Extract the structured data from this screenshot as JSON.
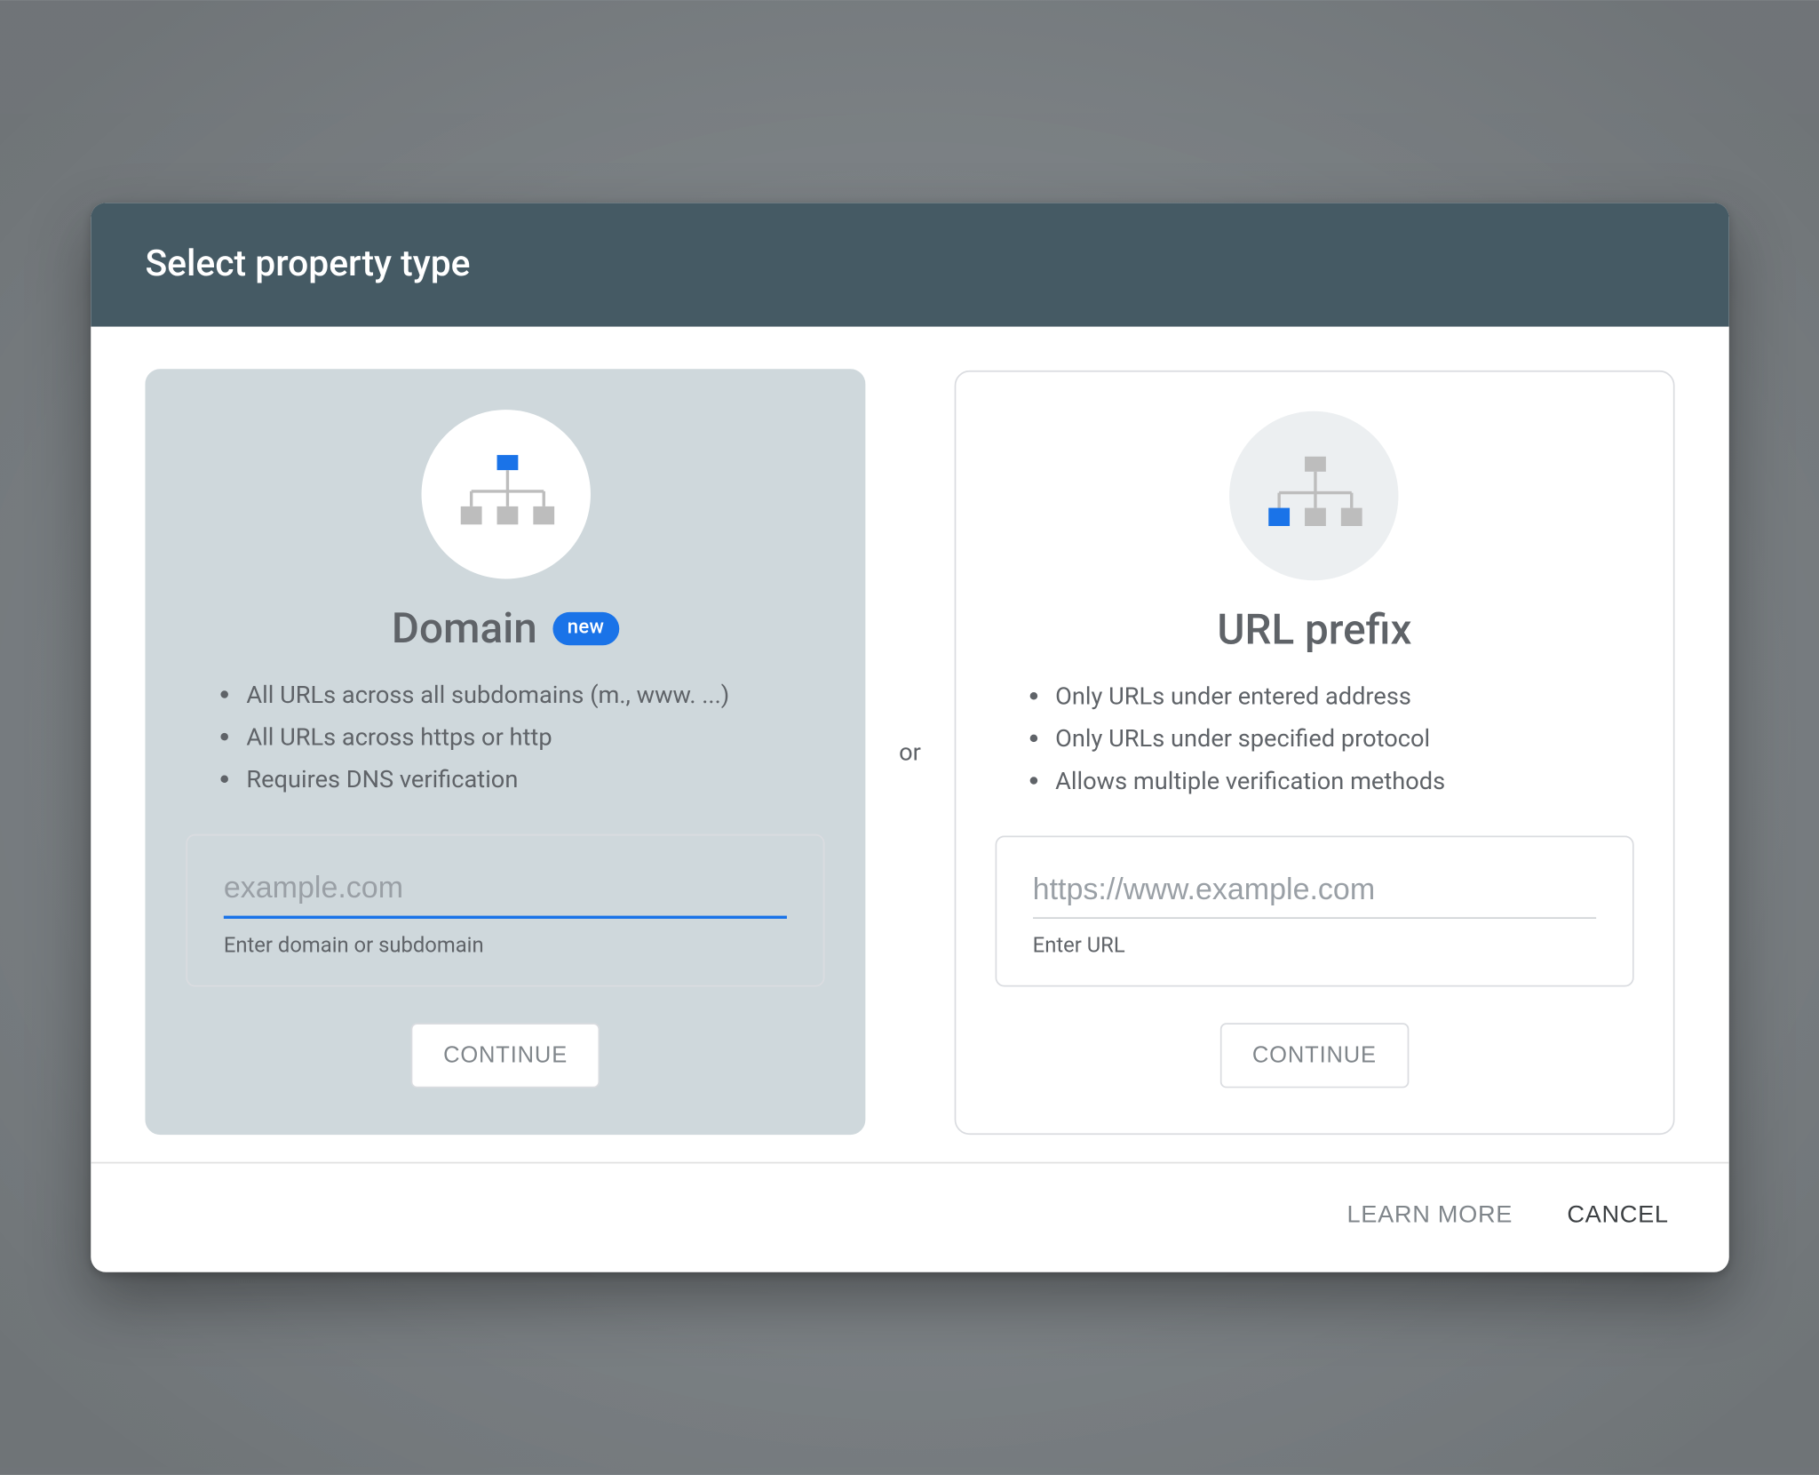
{
  "header": {
    "title": "Select property type"
  },
  "or_label": "or",
  "cards": {
    "domain": {
      "title": "Domain",
      "badge": "new",
      "bullets": [
        "All URLs across all subdomains (m., www. ...)",
        "All URLs across https or http",
        "Requires DNS verification"
      ],
      "input_placeholder": "example.com",
      "helper": "Enter domain or subdomain",
      "continue": "CONTINUE"
    },
    "url": {
      "title": "URL prefix",
      "bullets": [
        "Only URLs under entered address",
        "Only URLs under specified protocol",
        "Allows multiple verification methods"
      ],
      "input_placeholder": "https://www.example.com",
      "helper": "Enter URL",
      "continue": "CONTINUE"
    }
  },
  "footer": {
    "learn_more": "LEARN MORE",
    "cancel": "CANCEL"
  },
  "icons": {
    "sitemap_domain": "sitemap-icon",
    "sitemap_url": "sitemap-icon"
  },
  "colors": {
    "accent": "#1a73e8",
    "header_bg": "#455a64",
    "selected_card_bg": "#cfd8dc",
    "text_muted": "#5f6368"
  }
}
